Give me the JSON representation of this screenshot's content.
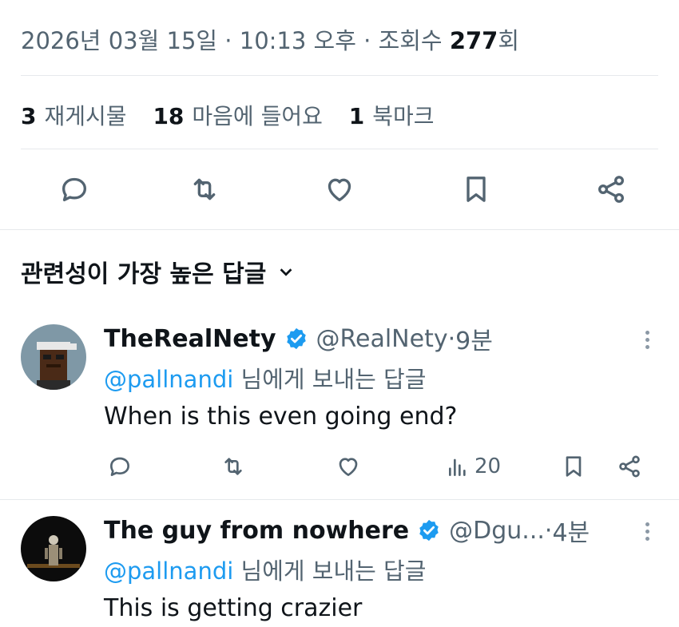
{
  "meta": {
    "date": "2026년 03월 15일",
    "sep1": " · ",
    "time": "10:13 오후",
    "sep2": " · ",
    "views_label": "조회수 ",
    "views_count": "277",
    "views_suffix": "회"
  },
  "stats": {
    "reposts_count": "3",
    "reposts_label": "재게시물",
    "likes_count": "18",
    "likes_label": "마음에 들어요",
    "bookmarks_count": "1",
    "bookmarks_label": "북마크"
  },
  "sort": {
    "label": "관련성이 가장 높은 답글"
  },
  "replies": [
    {
      "name": "TheRealNety",
      "handle": "@RealNety",
      "time_sep": " · ",
      "time": "9분",
      "replying_to": "@pallnandi",
      "replying_suffix": " 님에게 보내는 답글",
      "text": "When is this even going end?",
      "views": "20"
    },
    {
      "name": "The guy from nowhere",
      "handle": "@Dgu...",
      "time_sep": " · ",
      "time": "4분",
      "replying_to": "@pallnandi",
      "replying_suffix": " 님에게 보내는 답글",
      "text": "This is getting crazier"
    }
  ],
  "colors": {
    "accent": "#1d9bf0",
    "muted": "#536471",
    "text": "#0f1419",
    "divider": "#e6e9ec"
  }
}
